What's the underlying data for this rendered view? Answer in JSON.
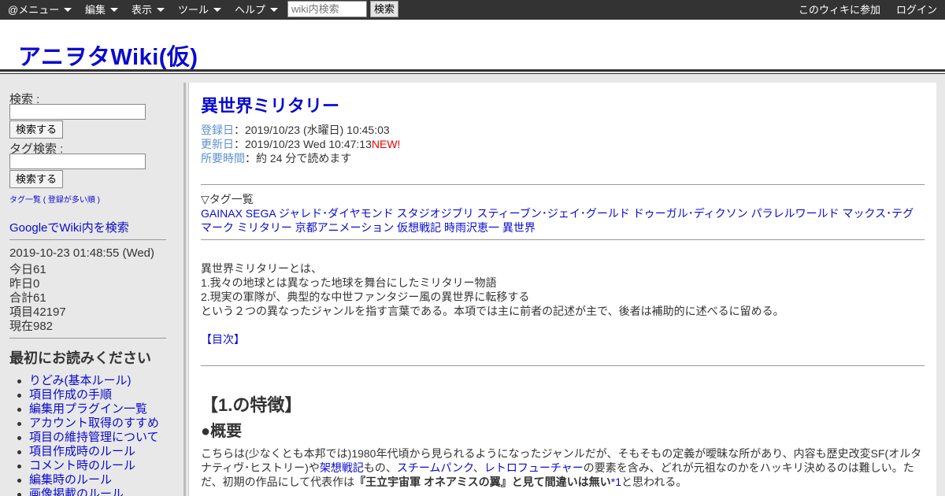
{
  "topbar": {
    "menu_label": "@メニュー",
    "edit_label": "編集",
    "view_label": "表示",
    "tools_label": "ツール",
    "help_label": "ヘルプ",
    "search_placeholder": "wiki内検索",
    "search_button": "検索",
    "join_label": "このウィキに参加",
    "login_label": "ログイン"
  },
  "header": {
    "site_title": "アニヲタWiki(仮)"
  },
  "sidebar": {
    "search_label": "検索 :",
    "search_button": "検索する",
    "tag_search_label": "タグ検索 :",
    "tag_search_button": "検索する",
    "tag_list_prefix": "タグ一覧 ( ",
    "tag_list_link": "登録が多い順",
    "tag_list_suffix": " )",
    "google_search": "GoogleでWiki内を検索",
    "stats": {
      "datetime": "2019-10-23 01:48:55 (Wed)",
      "today": "今日61",
      "yesterday": "昨日0",
      "total": "合計61",
      "items": "項目42197",
      "now": "現在982"
    },
    "read_first_heading": "最初にお読みください",
    "read_first_items": [
      "りどみ(基本ルール)",
      "項目作成の手順",
      "編集用プラグイン一覧",
      "アカウント取得のすすめ",
      "項目の維持管理について",
      "項目作成時のルール",
      "コメント時のルール",
      "編集時のルール",
      "画像掲載のルール"
    ]
  },
  "article": {
    "title": "異世界ミリタリー",
    "registered_label": "登録日",
    "registered_value": "：2019/10/23 (水曜日) 10:45:03",
    "updated_label": "更新日",
    "updated_value": "：2019/10/23 Wed 10:47:13",
    "updated_new": "NEW!",
    "readtime_label": "所要時間",
    "readtime_value": "：約 24 分で読めます",
    "tag_list_heading": "▽タグ一覧",
    "tags_line1": [
      "GAINAX",
      "SEGA",
      "ジャレド･ダイヤモンド",
      "スタジオジブリ",
      "スティーブン･ジェイ･グールド",
      "ドゥーガル･ディクソン",
      "パラレルワールド",
      "マックス･テグ"
    ],
    "tags_line2": [
      "マーク",
      "ミリタリー",
      "京都アニメーション",
      "仮想戦記",
      "時雨沢恵一",
      "異世界"
    ],
    "intro_lines": [
      "異世界ミリタリーとは、",
      "1.我々の地球とは異なった地球を舞台にしたミリタリー物語",
      "2.現実の軍隊が、典型的な中世ファンタジー風の異世界に転移する",
      "という２つの異なったジャンルを指す言葉である。本項では主に前者の記述が主で、後者は補助的に述べるに留める。"
    ],
    "toc_link": "【目次】",
    "section_heading": "【1.の特徴】",
    "subsection_heading": "●概要",
    "body_line1": "こちらは(少なくとも本邦では)1980年代頃から見られるようになったジャンルだが、そもそもの定義が曖昧な所があり、内容も歴史改変SF(オルタ",
    "body_line2_a": "ナティヴ･ヒストリー)や",
    "body_line2_link1": "架想戦記",
    "body_line2_b": "もの、",
    "body_line2_link2": "スチームパンク",
    "body_line2_c": "、",
    "body_line2_link3": "レトロフューチャー",
    "body_line2_d": "の要素を含み、どれが元祖なのかをハッキリ決めるのは難しい。た",
    "body_line3_a": "だ、初期の作品にして代表作は",
    "body_line3_bold": "『王立宇宙軍 オネアミスの翼』と見て間違いは無い",
    "body_line3_note": "*1",
    "body_line3_b": "と思われる。"
  }
}
